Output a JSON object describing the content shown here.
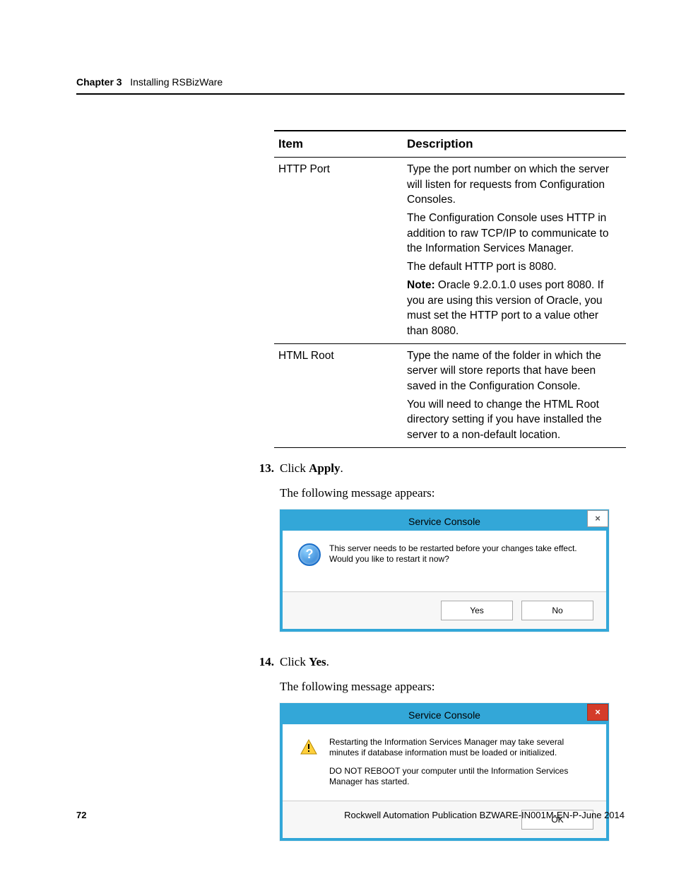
{
  "header": {
    "chapter": "Chapter 3",
    "title": "Installing RSBizWare"
  },
  "table": {
    "col_item": "Item",
    "col_desc": "Description",
    "rows": [
      {
        "item": "HTTP Port",
        "p1": "Type the port number on which the server will listen for requests from Configuration Consoles.",
        "p2": "The Configuration Console uses HTTP in addition to raw TCP/IP to communicate to the Information Services Manager.",
        "p3": "The default HTTP port is 8080.",
        "note_label": "Note:",
        "note": " Oracle 9.2.0.1.0 uses port 8080. If you are using this version of Oracle, you must set the HTTP port to a value other than 8080."
      },
      {
        "item": "HTML Root",
        "p1": "Type the name of the folder in which the server will store reports that have been saved in the Configuration Console.",
        "p2": "You will need to change the HTML Root directory setting if you have installed the server to a non-default location."
      }
    ]
  },
  "steps": {
    "s13": {
      "num": "13.",
      "text_pre": "Click ",
      "text_bold": "Apply",
      "text_post": ".",
      "followup": "The following message appears:"
    },
    "s14": {
      "num": "14.",
      "text_pre": "Click ",
      "text_bold": "Yes",
      "text_post": ".",
      "followup": "The following message appears:"
    }
  },
  "dialog1": {
    "title": "Service Console",
    "close": "×",
    "msg_l1": "This server needs to be restarted before your changes take effect.",
    "msg_l2": "Would you like to restart it now?",
    "yes": "Yes",
    "no": "No",
    "qmark": "?"
  },
  "dialog2": {
    "title": "Service Console",
    "close": "×",
    "msg_p1": "Restarting the Information Services Manager may take several minutes if database information must be loaded or initialized.",
    "msg_p2": "DO NOT REBOOT your computer until the Information Services Manager has started.",
    "ok": "OK"
  },
  "footer": {
    "page": "72",
    "pub": "Rockwell Automation Publication BZWARE-IN001M-EN-P-June 2014"
  }
}
